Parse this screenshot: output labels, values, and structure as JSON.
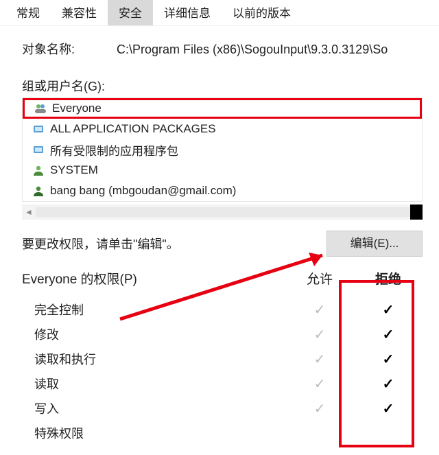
{
  "tabs": {
    "t0": "常规",
    "t1": "兼容性",
    "t2": "安全",
    "t3": "详细信息",
    "t4": "以前的版本",
    "active_index": 2
  },
  "object": {
    "label": "对象名称:",
    "value": "C:\\Program Files (x86)\\SogouInput\\9.3.0.3129\\So"
  },
  "groups": {
    "label": "组或用户名(G):",
    "items": [
      {
        "name": "Everyone",
        "icon": "users"
      },
      {
        "name": "ALL APPLICATION PACKAGES",
        "icon": "pkg"
      },
      {
        "name": "所有受限制的应用程序包",
        "icon": "pkg"
      },
      {
        "name": "SYSTEM",
        "icon": "user"
      },
      {
        "name": "bang bang (mbgoudan@gmail.com)",
        "icon": "user"
      }
    ]
  },
  "edit": {
    "hint": "要更改权限，请单击\"编辑\"。",
    "button": "编辑(E)..."
  },
  "perm": {
    "label_prefix": "Everyone 的权限(P)",
    "col_allow": "允许",
    "col_deny": "拒绝",
    "rows": [
      {
        "name": "完全控制",
        "allow": true,
        "deny": true
      },
      {
        "name": "修改",
        "allow": true,
        "deny": true
      },
      {
        "name": "读取和执行",
        "allow": true,
        "deny": true
      },
      {
        "name": "读取",
        "allow": true,
        "deny": true
      },
      {
        "name": "写入",
        "allow": true,
        "deny": true
      },
      {
        "name": "特殊权限",
        "allow": false,
        "deny": false
      }
    ]
  },
  "colors": {
    "highlight": "#e60012",
    "tab_selected_bg": "#d9d9d9",
    "btn_bg": "#e1e1e1",
    "allow_mark": "#bbbbbb",
    "deny_mark": "#000000"
  }
}
